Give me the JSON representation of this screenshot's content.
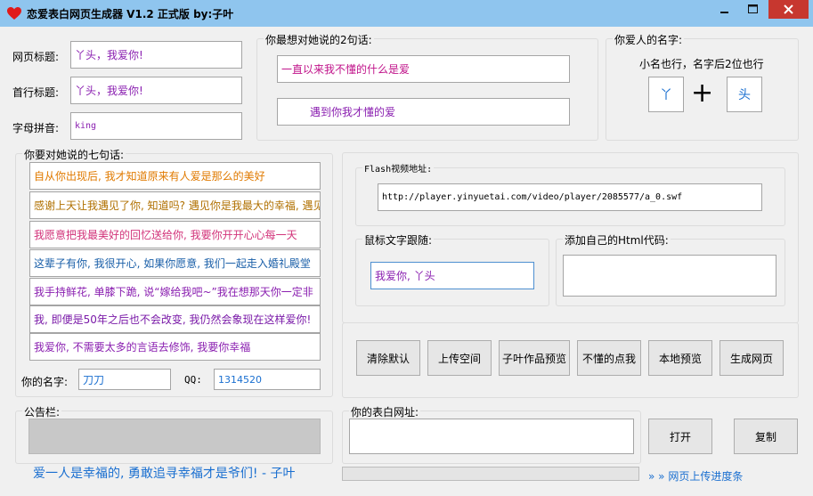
{
  "window": {
    "title": "恋爱表白网页生成器 V1.2 正式版  by:子叶",
    "title_color": "#8fc5ee",
    "close_color": "#c7372f",
    "controls": [
      "minimize-icon",
      "maximize-icon",
      "close-icon"
    ]
  },
  "fields": {
    "page_title_label": "网页标题:",
    "page_title_value": "丫头，我爱你!",
    "first_title_label": "首行标题:",
    "first_title_value": "丫头，我爱你!",
    "pinyin_label": "字母拼音:",
    "pinyin_value": "king"
  },
  "two_lines": {
    "legend": "你最想对她说的2句话:",
    "line1": "一直以来我不懂的什么是爱",
    "line2": "遇到你我才懂的爱"
  },
  "lover": {
    "legend": "你爱人的名字:",
    "hint": "小名也行，名字后2位也行",
    "char1": "丫",
    "plus": "+",
    "char2": "头"
  },
  "seven_lines": {
    "legend": "你要对她说的七句话:",
    "lines": [
      {
        "text": "自从你出现后, 我才知道原来有人爱是那么的美好",
        "color": "#e07a00"
      },
      {
        "text": "感谢上天让我遇见了你, 知道吗? 遇见你是我最大的幸福, 遇见",
        "color": "#b07000"
      },
      {
        "text": "我愿意把我最美好的回忆送给你, 我要你开开心心每一天",
        "color": "#d2337a"
      },
      {
        "text": "这辈子有你, 我很开心, 如果你愿意, 我们一起走入婚礼殿堂",
        "color": "#1a5fa8"
      },
      {
        "text": "我手持鲜花, 单膝下跪, 说“嫁给我吧~”我在想那天你一定非",
        "color": "#8a1fb0"
      },
      {
        "text": "我, 即便是50年之后也不会改变, 我仍然会象现在这样爱你!",
        "color": "#7a1aa8"
      },
      {
        "text": "我爱你, 不需要太多的言语去修饰, 我要你幸福",
        "color": "#8a1fb0"
      }
    ]
  },
  "your_name": {
    "label": "你的名字:",
    "value": "刀刀"
  },
  "qq": {
    "label": "QQ:",
    "value": "1314520"
  },
  "flash": {
    "legend": "Flash视频地址:",
    "value": "http://player.yinyuetai.com/video/player/2085577/a_0.swf"
  },
  "mouse_text": {
    "legend": "鼠标文字跟随:",
    "value": "我爱你, 丫头"
  },
  "html_code": {
    "legend": "添加自己的Html代码:",
    "value": ""
  },
  "buttons": [
    {
      "label": "清除默认"
    },
    {
      "label": "上传空间"
    },
    {
      "label": "子叶作品预览"
    },
    {
      "label": "不懂的点我"
    },
    {
      "label": "本地预览"
    },
    {
      "label": "生成网页"
    }
  ],
  "notice": {
    "legend": "公告栏:"
  },
  "url": {
    "legend": "你的表白网址:",
    "value": "",
    "open": "打开",
    "copy": "复制"
  },
  "footer": {
    "slogan": "爱一人是幸福的, 勇敢追寻幸福才是爷们! - 子叶",
    "progress_label": "» » 网页上传进度条",
    "progress_value": 0
  }
}
